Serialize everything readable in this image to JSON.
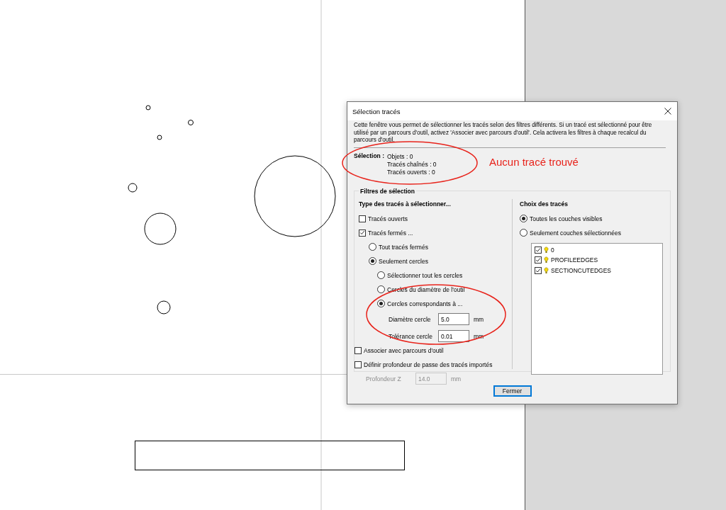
{
  "window": {
    "title": "Sélection tracés"
  },
  "description": "Cette fenêtre vous permet de sélectionner les tracés selon des filtres différents. Si un tracé est sélectionné pour être utilisé par un parcours d'outil, activez 'Associer avec parcours d'outil'. Cela activera les filtres à chaque recalcul du parcours d'outil.",
  "selection": {
    "label": "Sélection :",
    "lines": [
      "Objets : 0",
      "Tracés chaînés : 0",
      "Tracés ouverts : 0"
    ]
  },
  "annotation": "Aucun tracé trouvé",
  "filters": {
    "title": "Filtres de sélection",
    "type_heading": "Type des tracés à sélectionner...",
    "type_options": [
      {
        "kind": "checkbox",
        "label": "Tracés ouverts",
        "checked": false
      },
      {
        "kind": "checkbox",
        "label": "Tracés fermés ...",
        "checked": true,
        "children": [
          {
            "kind": "radio",
            "label": "Tout tracés fermés",
            "selected": false
          },
          {
            "kind": "radio",
            "label": "Seulement cercles",
            "selected": true,
            "children": [
              {
                "kind": "radio",
                "label": "Sélectionner tout les cercles",
                "selected": false
              },
              {
                "kind": "radio",
                "label": "Cercles du diamètre de l'outil",
                "selected": false
              },
              {
                "kind": "radio",
                "label": "Cercles correspondants à ...",
                "selected": true,
                "fields": [
                  {
                    "label": "Diamètre cercle",
                    "value": "5.0",
                    "unit": "mm"
                  },
                  {
                    "label": "Tolérance cercle",
                    "value": "0.01",
                    "unit": "mm"
                  }
                ]
              }
            ]
          }
        ]
      }
    ],
    "extra_options": [
      {
        "label": "Associer avec parcours d'outil",
        "checked": false
      },
      {
        "label": "Définir profondeur de passe des tracés importés",
        "checked": false
      }
    ],
    "depth_field": {
      "label": "Profondeur Z",
      "value": "14.0",
      "unit": "mm",
      "disabled": true
    },
    "choice_heading": "Choix des tracés",
    "choice_options": [
      {
        "label": "Toutes les couches visibles",
        "selected": true
      },
      {
        "label": "Seulement couches sélectionnées",
        "selected": false
      }
    ],
    "layers": [
      {
        "name": "0",
        "checked": true
      },
      {
        "name": "PROFILEEDGES",
        "checked": true
      },
      {
        "name": "SECTIONCUTEDGES",
        "checked": true
      }
    ]
  },
  "buttons": [
    "Fermer"
  ]
}
